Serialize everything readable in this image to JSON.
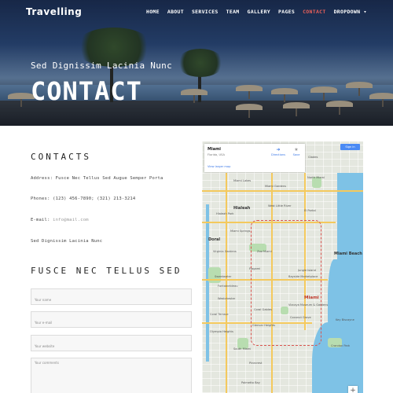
{
  "brand": "Travelling",
  "nav": [
    "HOME",
    "ABOUT",
    "SERVICES",
    "TEAM",
    "GALLERY",
    "PAGES",
    "CONTACT",
    "DROPDOWN"
  ],
  "nav_active": "CONTACT",
  "hero": {
    "subtitle": "Sed Dignissim Lacinia Nunc",
    "title": "CONTACT"
  },
  "contacts": {
    "heading": "CONTACTS",
    "address": "Address: Fusce Nec Tellus Sed Augue Semper Porta",
    "phones": "Phones: (123) 456-7890; (321) 213-3214",
    "email_label": "E-mail:",
    "email_value": "info@mail.com",
    "tagline": "Sed Dignissim Lacinia Nunc"
  },
  "form": {
    "heading": "FUSCE NEC TELLUS SED",
    "name_placeholder": "Your name",
    "email_placeholder": "Your e-mail",
    "website_placeholder": "Your website",
    "comments_placeholder": "Your comments"
  },
  "map": {
    "place": "Miami",
    "region": "Florida, USA",
    "view_link": "View larger map",
    "directions": "Directions",
    "save": "Save",
    "sign_in": "Sign in",
    "labels": [
      "Glades",
      "North Miami",
      "Miami Lakes",
      "Miami Gardens",
      "Hialeah",
      "Hialeah Park",
      "West Little River",
      "El Portal",
      "Doral",
      "Miami Springs",
      "Virginia Gardens",
      "Zoo Miami",
      "Jungle Island",
      "Miami Beach",
      "Sweetwater",
      "Fontainebleau",
      "Westchester",
      "Coral Terrace",
      "Coral Gables",
      "Coconut Grove",
      "Key Biscayne",
      "Miami",
      "Vizcaya Museum & Gardens",
      "Flagami",
      "Bayside Marketplace",
      "Pinecrest",
      "Palmetto Bay",
      "Glenvar Heights",
      "South Miami",
      "Olympia Heights",
      "Crandon Park"
    ],
    "colors": {
      "water": "#7ec2e6",
      "park": "#b8ddb0",
      "highway": "#f4c95d",
      "accent": "#e8605a"
    }
  }
}
